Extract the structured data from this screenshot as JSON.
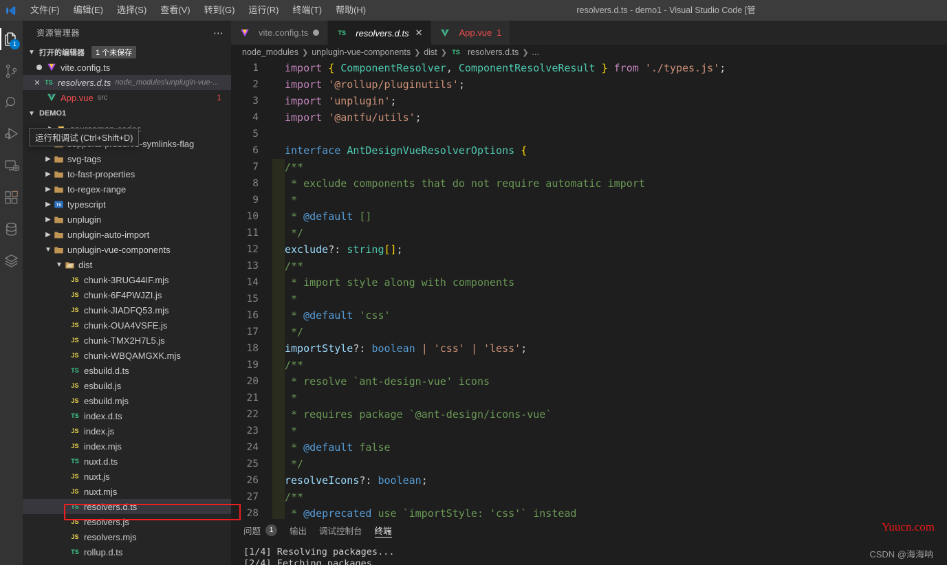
{
  "titlebar": {
    "logo_icon": "vscode-logo-icon",
    "window_title": "resolvers.d.ts - demo1 - Visual Studio Code [管",
    "menus": [
      {
        "label": "文件(F)"
      },
      {
        "label": "编辑(E)"
      },
      {
        "label": "选择(S)"
      },
      {
        "label": "查看(V)"
      },
      {
        "label": "转到(G)"
      },
      {
        "label": "运行(R)"
      },
      {
        "label": "终端(T)"
      },
      {
        "label": "帮助(H)"
      }
    ]
  },
  "activitybar": {
    "items": [
      {
        "name": "explorer-icon",
        "badge": "1",
        "active": true
      },
      {
        "name": "source-control-icon",
        "badge": "",
        "active": false
      },
      {
        "name": "search-icon",
        "badge": "",
        "active": false
      },
      {
        "name": "run-and-debug-icon",
        "badge": "",
        "active": false
      },
      {
        "name": "remote-explorer-icon",
        "badge": "",
        "active": false
      },
      {
        "name": "extensions-icon",
        "badge": "",
        "active": false
      },
      {
        "name": "database-icon",
        "badge": "",
        "active": false
      },
      {
        "name": "layers-icon",
        "badge": "",
        "active": false
      }
    ]
  },
  "sidebar": {
    "title": "资源管理器",
    "more_icon": "ellipsis-icon",
    "open_editors": {
      "label": "打开的编辑器",
      "unsaved_badge": "1 个未保存",
      "items": [
        {
          "name": "vite.config.ts",
          "icon": "vue-file-icon",
          "state": "dirty",
          "sub": "",
          "count": ""
        },
        {
          "name": "resolvers.d.ts",
          "icon": "ts-file-icon",
          "state": "active",
          "sub": "node_modules\\unplugin-vue-...",
          "count": ""
        },
        {
          "name": "App.vue",
          "icon": "vue-file-icon",
          "state": "error",
          "sub": "src",
          "count": "1"
        }
      ]
    },
    "workspace": {
      "label": "DEMO1",
      "hidden_row": "sourcemap-codec",
      "tree": [
        {
          "label": "supports-preserve-symlinks-flag",
          "type": "folder",
          "depth": 1,
          "expanded": false
        },
        {
          "label": "svg-tags",
          "type": "folder",
          "depth": 1,
          "expanded": false
        },
        {
          "label": "to-fast-properties",
          "type": "folder",
          "depth": 1,
          "expanded": false
        },
        {
          "label": "to-regex-range",
          "type": "folder",
          "depth": 1,
          "expanded": false
        },
        {
          "label": "typescript",
          "type": "folder-ts",
          "depth": 1,
          "expanded": false
        },
        {
          "label": "unplugin",
          "type": "folder",
          "depth": 1,
          "expanded": false
        },
        {
          "label": "unplugin-auto-import",
          "type": "folder",
          "depth": 1,
          "expanded": false
        },
        {
          "label": "unplugin-vue-components",
          "type": "folder",
          "depth": 1,
          "expanded": true
        },
        {
          "label": "dist",
          "type": "folder-open",
          "depth": 2,
          "expanded": true
        },
        {
          "label": "chunk-3RUG44IF.mjs",
          "type": "js",
          "depth": 3
        },
        {
          "label": "chunk-6F4PWJZI.js",
          "type": "js",
          "depth": 3
        },
        {
          "label": "chunk-JIADFQ53.mjs",
          "type": "js",
          "depth": 3
        },
        {
          "label": "chunk-OUA4VSFE.js",
          "type": "js",
          "depth": 3
        },
        {
          "label": "chunk-TMX2H7L5.js",
          "type": "js",
          "depth": 3
        },
        {
          "label": "chunk-WBQAMGXK.mjs",
          "type": "js",
          "depth": 3
        },
        {
          "label": "esbuild.d.ts",
          "type": "ts",
          "depth": 3
        },
        {
          "label": "esbuild.js",
          "type": "js",
          "depth": 3
        },
        {
          "label": "esbuild.mjs",
          "type": "js",
          "depth": 3
        },
        {
          "label": "index.d.ts",
          "type": "ts",
          "depth": 3
        },
        {
          "label": "index.js",
          "type": "js",
          "depth": 3
        },
        {
          "label": "index.mjs",
          "type": "js",
          "depth": 3
        },
        {
          "label": "nuxt.d.ts",
          "type": "ts",
          "depth": 3
        },
        {
          "label": "nuxt.js",
          "type": "js",
          "depth": 3
        },
        {
          "label": "nuxt.mjs",
          "type": "js",
          "depth": 3
        },
        {
          "label": "resolvers.d.ts",
          "type": "ts",
          "depth": 3,
          "selected": true
        },
        {
          "label": "resolvers.js",
          "type": "js",
          "depth": 3
        },
        {
          "label": "resolvers.mjs",
          "type": "js",
          "depth": 3
        },
        {
          "label": "rollup.d.ts",
          "type": "ts",
          "depth": 3
        }
      ]
    },
    "tooltip": "运行和调试 (Ctrl+Shift+D)"
  },
  "editor": {
    "tabs": [
      {
        "label": "vite.config.ts",
        "icon": "vue-file-icon",
        "active": false,
        "dirty": true,
        "close": "",
        "badge": ""
      },
      {
        "label": "resolvers.d.ts",
        "icon": "ts-file-icon",
        "active": true,
        "dirty": false,
        "close": "✕",
        "badge": ""
      },
      {
        "label": "App.vue",
        "icon": "vue-file-icon",
        "active": false,
        "dirty": false,
        "close": "",
        "badge": "1"
      }
    ],
    "breadcrumbs": [
      "node_modules",
      "unplugin-vue-components",
      "dist",
      "resolvers.d.ts",
      "..."
    ],
    "breadcrumb_file_icon": "ts-file-icon",
    "lines": [
      {
        "n": "1",
        "guide": false,
        "tokens": [
          {
            "t": "import",
            "c": "kw"
          },
          {
            "t": " ",
            "c": "op"
          },
          {
            "t": "{",
            "c": "brace-y"
          },
          {
            "t": " ",
            "c": "op"
          },
          {
            "t": "ComponentResolver",
            "c": "type"
          },
          {
            "t": ", ",
            "c": "punc"
          },
          {
            "t": "ComponentResolveResult",
            "c": "type"
          },
          {
            "t": " ",
            "c": "op"
          },
          {
            "t": "}",
            "c": "brace-y"
          },
          {
            "t": " ",
            "c": "op"
          },
          {
            "t": "from",
            "c": "kw"
          },
          {
            "t": " ",
            "c": "op"
          },
          {
            "t": "'./types.js'",
            "c": "str"
          },
          {
            "t": ";",
            "c": "punc"
          }
        ]
      },
      {
        "n": "2",
        "guide": false,
        "tokens": [
          {
            "t": "import",
            "c": "kw"
          },
          {
            "t": " ",
            "c": "op"
          },
          {
            "t": "'@rollup/pluginutils'",
            "c": "str"
          },
          {
            "t": ";",
            "c": "punc"
          }
        ]
      },
      {
        "n": "3",
        "guide": false,
        "tokens": [
          {
            "t": "import",
            "c": "kw"
          },
          {
            "t": " ",
            "c": "op"
          },
          {
            "t": "'unplugin'",
            "c": "str"
          },
          {
            "t": ";",
            "c": "punc"
          }
        ]
      },
      {
        "n": "4",
        "guide": false,
        "tokens": [
          {
            "t": "import",
            "c": "kw"
          },
          {
            "t": " ",
            "c": "op"
          },
          {
            "t": "'@antfu/utils'",
            "c": "str"
          },
          {
            "t": ";",
            "c": "punc"
          }
        ]
      },
      {
        "n": "5",
        "guide": false,
        "tokens": []
      },
      {
        "n": "6",
        "guide": false,
        "tokens": [
          {
            "t": "interface",
            "c": "kw2"
          },
          {
            "t": " ",
            "c": "op"
          },
          {
            "t": "AntDesignVueResolverOptions",
            "c": "type"
          },
          {
            "t": " ",
            "c": "op"
          },
          {
            "t": "{",
            "c": "brace-y"
          }
        ]
      },
      {
        "n": "7",
        "guide": true,
        "tokens": [
          {
            "t": "/**",
            "c": "cmt"
          }
        ]
      },
      {
        "n": "8",
        "guide": true,
        "tokens": [
          {
            "t": " * exclude components that do not require automatic import",
            "c": "cmt"
          }
        ]
      },
      {
        "n": "9",
        "guide": true,
        "tokens": [
          {
            "t": " *",
            "c": "cmt"
          }
        ]
      },
      {
        "n": "10",
        "guide": true,
        "tokens": [
          {
            "t": " * ",
            "c": "cmt"
          },
          {
            "t": "@default",
            "c": "cmt-tag"
          },
          {
            "t": " []",
            "c": "cmt"
          }
        ]
      },
      {
        "n": "11",
        "guide": true,
        "tokens": [
          {
            "t": " */",
            "c": "cmt"
          }
        ]
      },
      {
        "n": "12",
        "guide": true,
        "tokens": [
          {
            "t": "exclude",
            "c": "prop"
          },
          {
            "t": "?: ",
            "c": "punc"
          },
          {
            "t": "string",
            "c": "type"
          },
          {
            "t": "[]",
            "c": "brace-y"
          },
          {
            "t": ";",
            "c": "punc"
          }
        ]
      },
      {
        "n": "13",
        "guide": true,
        "tokens": [
          {
            "t": "/**",
            "c": "cmt"
          }
        ]
      },
      {
        "n": "14",
        "guide": true,
        "tokens": [
          {
            "t": " * import style along with components",
            "c": "cmt"
          }
        ]
      },
      {
        "n": "15",
        "guide": true,
        "tokens": [
          {
            "t": " *",
            "c": "cmt"
          }
        ]
      },
      {
        "n": "16",
        "guide": true,
        "tokens": [
          {
            "t": " * ",
            "c": "cmt"
          },
          {
            "t": "@default",
            "c": "cmt-tag"
          },
          {
            "t": " 'css'",
            "c": "cmt"
          }
        ]
      },
      {
        "n": "17",
        "guide": true,
        "tokens": [
          {
            "t": " */",
            "c": "cmt"
          }
        ]
      },
      {
        "n": "18",
        "guide": true,
        "tokens": [
          {
            "t": "importStyle",
            "c": "prop"
          },
          {
            "t": "?: ",
            "c": "punc"
          },
          {
            "t": "boolean",
            "c": "kw2"
          },
          {
            "t": " ",
            "c": "op"
          },
          {
            "t": "|",
            "c": "str"
          },
          {
            "t": " ",
            "c": "op"
          },
          {
            "t": "'css'",
            "c": "str"
          },
          {
            "t": " ",
            "c": "op"
          },
          {
            "t": "|",
            "c": "str"
          },
          {
            "t": " ",
            "c": "op"
          },
          {
            "t": "'less'",
            "c": "str"
          },
          {
            "t": ";",
            "c": "punc"
          }
        ]
      },
      {
        "n": "19",
        "guide": true,
        "tokens": [
          {
            "t": "/**",
            "c": "cmt"
          }
        ]
      },
      {
        "n": "20",
        "guide": true,
        "tokens": [
          {
            "t": " * resolve `ant-design-vue' icons",
            "c": "cmt"
          }
        ]
      },
      {
        "n": "21",
        "guide": true,
        "tokens": [
          {
            "t": " *",
            "c": "cmt"
          }
        ]
      },
      {
        "n": "22",
        "guide": true,
        "tokens": [
          {
            "t": " * requires package `@ant-design/icons-vue`",
            "c": "cmt"
          }
        ]
      },
      {
        "n": "23",
        "guide": true,
        "tokens": [
          {
            "t": " *",
            "c": "cmt"
          }
        ]
      },
      {
        "n": "24",
        "guide": true,
        "tokens": [
          {
            "t": " * ",
            "c": "cmt"
          },
          {
            "t": "@default",
            "c": "cmt-tag"
          },
          {
            "t": " false",
            "c": "cmt"
          }
        ]
      },
      {
        "n": "25",
        "guide": true,
        "tokens": [
          {
            "t": " */",
            "c": "cmt"
          }
        ]
      },
      {
        "n": "26",
        "guide": true,
        "tokens": [
          {
            "t": "resolveIcons",
            "c": "prop"
          },
          {
            "t": "?: ",
            "c": "punc"
          },
          {
            "t": "boolean",
            "c": "kw2"
          },
          {
            "t": ";",
            "c": "punc"
          }
        ]
      },
      {
        "n": "27",
        "guide": true,
        "tokens": [
          {
            "t": "/**",
            "c": "cmt"
          }
        ]
      },
      {
        "n": "28",
        "guide": true,
        "tokens": [
          {
            "t": " * ",
            "c": "cmt"
          },
          {
            "t": "@deprecated",
            "c": "cmt-tag"
          },
          {
            "t": " use `importStyle: 'css'` instead",
            "c": "cmt"
          }
        ]
      }
    ]
  },
  "panel": {
    "tabs": [
      {
        "label": "问题",
        "badge": "1",
        "active": false
      },
      {
        "label": "输出",
        "badge": "",
        "active": false
      },
      {
        "label": "调试控制台",
        "badge": "",
        "active": false
      },
      {
        "label": "终端",
        "badge": "",
        "active": true
      }
    ],
    "terminal_lines": [
      "[1/4] Resolving packages...",
      "[2/4] Fetching packages"
    ]
  },
  "watermarks": {
    "primary": "Yuucn.com",
    "secondary": "CSDN @海海呐"
  },
  "colors": {
    "accent": "#007acc",
    "error": "#f14c4c",
    "annotation": "#f01e1e",
    "editor_bg": "#1e1e1e",
    "sidebar_bg": "#252526",
    "activitybar_bg": "#333333",
    "titlebar_bg": "#3c3c3c"
  }
}
